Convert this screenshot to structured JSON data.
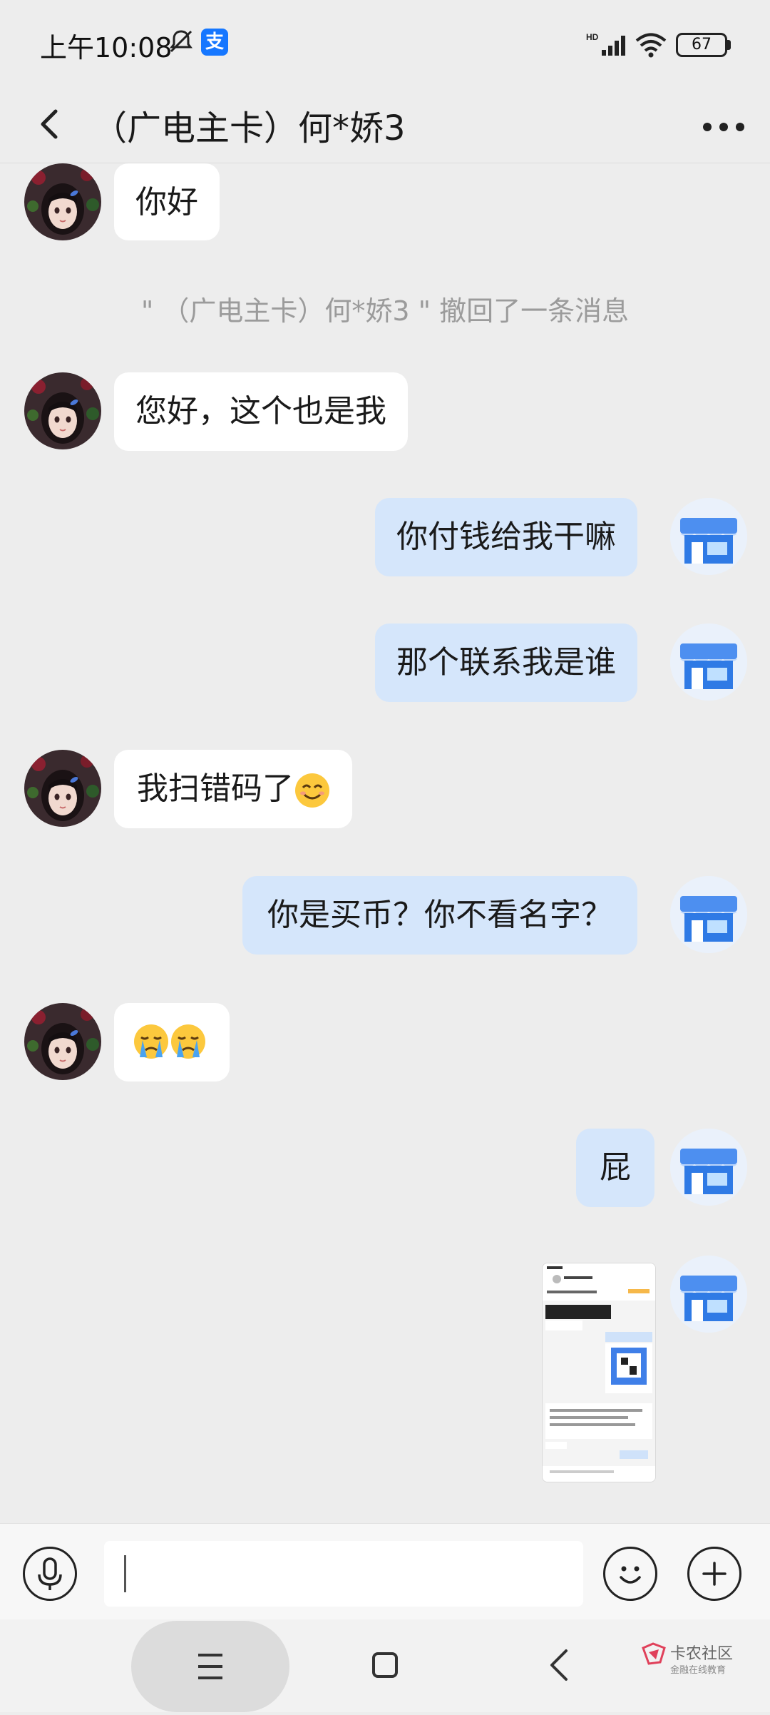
{
  "status_bar": {
    "time": "上午10:08",
    "network": "HD",
    "battery": "67",
    "icons": [
      "bell-mute-icon",
      "alipay-icon",
      "signal-icon",
      "wifi-icon",
      "battery-icon"
    ]
  },
  "header": {
    "title": "（广电主卡）何*娇3",
    "back_icon": "chevron-left-icon",
    "more_icon": "more-dots-icon"
  },
  "messages": [
    {
      "side": "left",
      "text": "你好"
    },
    {
      "side": "system",
      "text": "\" （广电主卡）何*娇3 \" 撤回了一条消息"
    },
    {
      "side": "left",
      "text": "您好，这个也是我"
    },
    {
      "side": "right",
      "text": "你付钱给我干嘛"
    },
    {
      "side": "right",
      "text": "那个联系我是谁"
    },
    {
      "side": "left",
      "text": "我扫错码了",
      "emoji": "smile-emoji"
    },
    {
      "side": "right",
      "text": "你是买币？你不看名字？"
    },
    {
      "side": "left",
      "emoji": "crying-emoji x2"
    },
    {
      "side": "right",
      "text": "屁"
    },
    {
      "side": "right",
      "type": "image",
      "content": "chat-screenshot-thumbnail"
    }
  ],
  "input_bar": {
    "placeholder": "",
    "value": "",
    "icons": [
      "microphone-icon",
      "emoji-icon",
      "plus-icon"
    ]
  },
  "nav_bar": {
    "icons": [
      "menu-icon",
      "home-square-icon",
      "back-icon"
    ]
  },
  "watermark": {
    "title": "卡农社区",
    "subtitle": "金融在线教育"
  },
  "colors": {
    "background": "#ededed",
    "bubble_left": "#ffffff",
    "bubble_right": "#d5e6fb",
    "system_text": "#9b9b9b",
    "shop_blue": "#2f7ae5"
  }
}
